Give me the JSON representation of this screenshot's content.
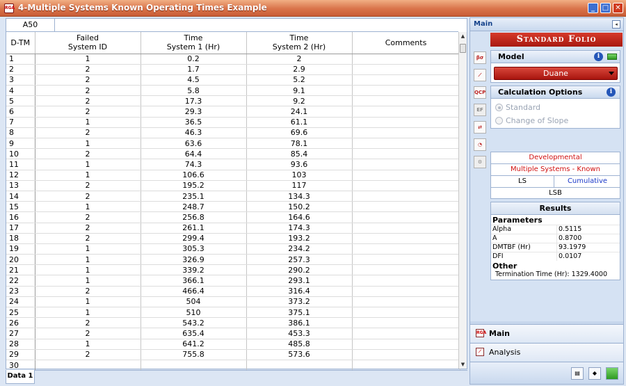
{
  "window": {
    "title": "4-Multiple Systems Known Operating Times Example"
  },
  "sheet": {
    "cell_ref": "A50",
    "columns": [
      "D-TM",
      "Failed\nSystem ID",
      "Time\nSystem 1 (Hr)",
      "Time\nSystem 2 (Hr)",
      "Comments"
    ],
    "rows": [
      [
        "1",
        "1",
        "0.2",
        "2",
        ""
      ],
      [
        "2",
        "2",
        "1.7",
        "2.9",
        ""
      ],
      [
        "3",
        "2",
        "4.5",
        "5.2",
        ""
      ],
      [
        "4",
        "2",
        "5.8",
        "9.1",
        ""
      ],
      [
        "5",
        "2",
        "17.3",
        "9.2",
        ""
      ],
      [
        "6",
        "2",
        "29.3",
        "24.1",
        ""
      ],
      [
        "7",
        "1",
        "36.5",
        "61.1",
        ""
      ],
      [
        "8",
        "2",
        "46.3",
        "69.6",
        ""
      ],
      [
        "9",
        "1",
        "63.6",
        "78.1",
        ""
      ],
      [
        "10",
        "2",
        "64.4",
        "85.4",
        ""
      ],
      [
        "11",
        "1",
        "74.3",
        "93.6",
        ""
      ],
      [
        "12",
        "1",
        "106.6",
        "103",
        ""
      ],
      [
        "13",
        "2",
        "195.2",
        "117",
        ""
      ],
      [
        "14",
        "2",
        "235.1",
        "134.3",
        ""
      ],
      [
        "15",
        "1",
        "248.7",
        "150.2",
        ""
      ],
      [
        "16",
        "2",
        "256.8",
        "164.6",
        ""
      ],
      [
        "17",
        "2",
        "261.1",
        "174.3",
        ""
      ],
      [
        "18",
        "2",
        "299.4",
        "193.2",
        ""
      ],
      [
        "19",
        "1",
        "305.3",
        "234.2",
        ""
      ],
      [
        "20",
        "1",
        "326.9",
        "257.3",
        ""
      ],
      [
        "21",
        "1",
        "339.2",
        "290.2",
        ""
      ],
      [
        "22",
        "1",
        "366.1",
        "293.1",
        ""
      ],
      [
        "23",
        "2",
        "466.4",
        "316.4",
        ""
      ],
      [
        "24",
        "1",
        "504",
        "373.2",
        ""
      ],
      [
        "25",
        "1",
        "510",
        "375.1",
        ""
      ],
      [
        "26",
        "2",
        "543.2",
        "386.1",
        ""
      ],
      [
        "27",
        "2",
        "635.4",
        "453.3",
        ""
      ],
      [
        "28",
        "1",
        "641.2",
        "485.8",
        ""
      ],
      [
        "29",
        "2",
        "755.8",
        "573.6",
        ""
      ],
      [
        "30",
        "",
        "",
        "",
        ""
      ]
    ],
    "tab": "Data 1"
  },
  "panel": {
    "header": "Main",
    "folio_title": "Standard Folio",
    "model": {
      "label": "Model",
      "value": "Duane"
    },
    "calc": {
      "label": "Calculation Options",
      "options": [
        "Standard",
        "Change of Slope"
      ],
      "selected": "Standard"
    },
    "method": {
      "row1": "Developmental",
      "row2": "Multiple Systems - Known",
      "left": "LS",
      "right": "Cumulative",
      "row4": "LSB"
    },
    "results": {
      "title": "Results",
      "params_label": "Parameters",
      "params": [
        {
          "k": "Alpha",
          "v": "0.5115"
        },
        {
          "k": "A",
          "v": "0.8700"
        },
        {
          "k": "DMTBF (Hr)",
          "v": "93.1979"
        },
        {
          "k": "DFI",
          "v": "0.0107"
        }
      ],
      "other_label": "Other",
      "termination": "Termination Time (Hr): 1329.4000"
    },
    "nav": {
      "main": "Main",
      "analysis": "Analysis"
    }
  },
  "colors": {
    "title_bar": "#d9734a",
    "accent_red": "#c0180f",
    "panel_bg": "#d5e2f3"
  }
}
